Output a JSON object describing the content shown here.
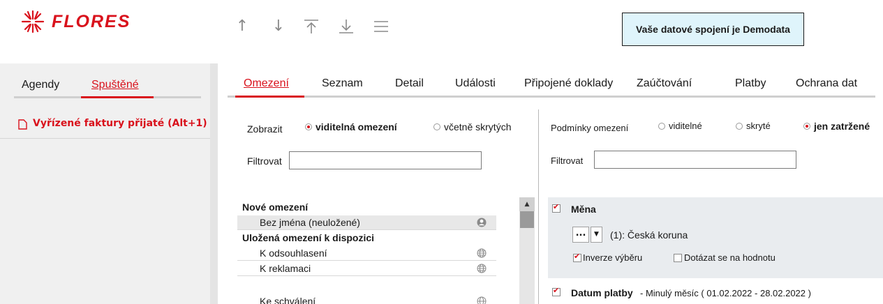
{
  "app": {
    "logo_text": "FLORES"
  },
  "toolbar": {
    "items": [
      "move-up",
      "move-down",
      "move-top",
      "move-bottom",
      "menu"
    ]
  },
  "connection": {
    "text": "Vaše datové spojení je Demodata"
  },
  "left_tabs": [
    "Agendy",
    "Spuštěné"
  ],
  "agenda": {
    "label": "Vyřízené faktury přijaté (Alt+1)"
  },
  "main_tabs": [
    "Omezení",
    "Seznam",
    "Detail",
    "Události",
    "Připojené doklady",
    "Zaúčtování",
    "Platby",
    "Ochrana dat"
  ],
  "left_pane": {
    "show_label": "Zobrazit",
    "show_options": [
      "viditelná omezení",
      "včetně skrytých"
    ],
    "show_selected": 0,
    "filter_label": "Filtrovat",
    "filter_value": "",
    "list": {
      "groups": [
        {
          "title": "Nové omezení",
          "items": [
            {
              "label": "Bez jména (neuložené)",
              "icon": "user-icon",
              "selected": true
            }
          ]
        },
        {
          "title": "Uložená omezení k dispozici",
          "items": [
            {
              "label": "K odsouhlasení",
              "icon": "globe-icon"
            },
            {
              "label": "K reklamaci",
              "icon": "globe-icon"
            },
            {
              "label": "Ke schválení",
              "icon": "globe-icon"
            }
          ]
        }
      ]
    }
  },
  "right_pane": {
    "conditions_label": "Podmínky omezení",
    "options": [
      "viditelné",
      "skryté",
      "jen zatržené"
    ],
    "selected": 2,
    "filter_label": "Filtrovat",
    "filter_value": "",
    "conditions": [
      {
        "title": "Měna",
        "checked": true,
        "dots": "...",
        "value": "(1): Česká koruna",
        "inverse_label": "Inverze výběru",
        "inverse_checked": true,
        "ask_label": "Dotázat se na hodnotu",
        "ask_checked": false
      },
      {
        "title": "Datum platby",
        "checked": true,
        "detail": "- Minulý měsíc ( 01.02.2022 - 28.02.2022 )"
      }
    ]
  },
  "colors": {
    "accent": "#d9121c",
    "info_box": "#dff4fb",
    "panel": "#f0f0f0"
  }
}
